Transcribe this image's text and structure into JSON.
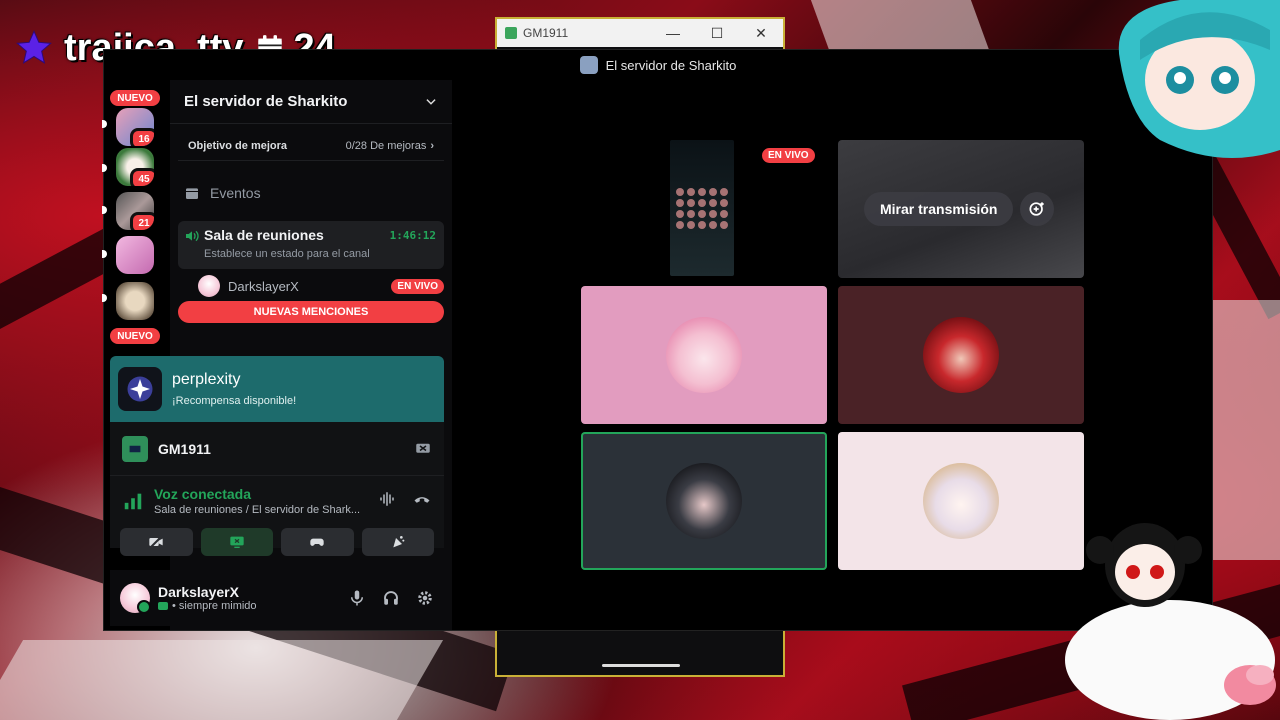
{
  "overlay": {
    "username": "trajica_ttv",
    "day_count": "24"
  },
  "gm_window": {
    "title": "GM1911",
    "minimize": "—",
    "maximize": "☐",
    "close": "✕"
  },
  "discord": {
    "window_title": "El servidor de Sharkito",
    "rail": {
      "nuevo_top": "NUEVO",
      "nuevo_bottom": "NUEVO",
      "badges": [
        "16",
        "45",
        "21"
      ]
    },
    "server": {
      "name": "El servidor de Sharkito",
      "boost_label": "Objetivo de mejora",
      "boost_progress": "0/28 De mejoras",
      "events_label": "Eventos"
    },
    "voice_channel": {
      "name": "Sala de reuniones",
      "timer": "1:46:12",
      "status_placeholder": "Establece un estado para el canal",
      "member_name": "DarkslayerX",
      "member_live": "EN VIVO"
    },
    "mentions_label": "NUEVAS MENCIONES",
    "promo": {
      "name": "perplexity",
      "subtitle": "¡Recompensa disponible!"
    },
    "activity": {
      "name": "GM1911"
    },
    "voice_connection": {
      "title": "Voz conectada",
      "subtitle": "Sala de reuniones / El servidor de Shark..."
    },
    "user": {
      "name": "DarkslayerX",
      "status": "• siempre mimido"
    },
    "stage": {
      "live_label": "EN VIVO",
      "watch_label": "Mirar transmisión"
    },
    "colors": {
      "accent_green": "#23a55a",
      "alert_red": "#f23f43",
      "promo_teal": "#1d6b6c",
      "frame_gold": "#c9b037"
    }
  }
}
